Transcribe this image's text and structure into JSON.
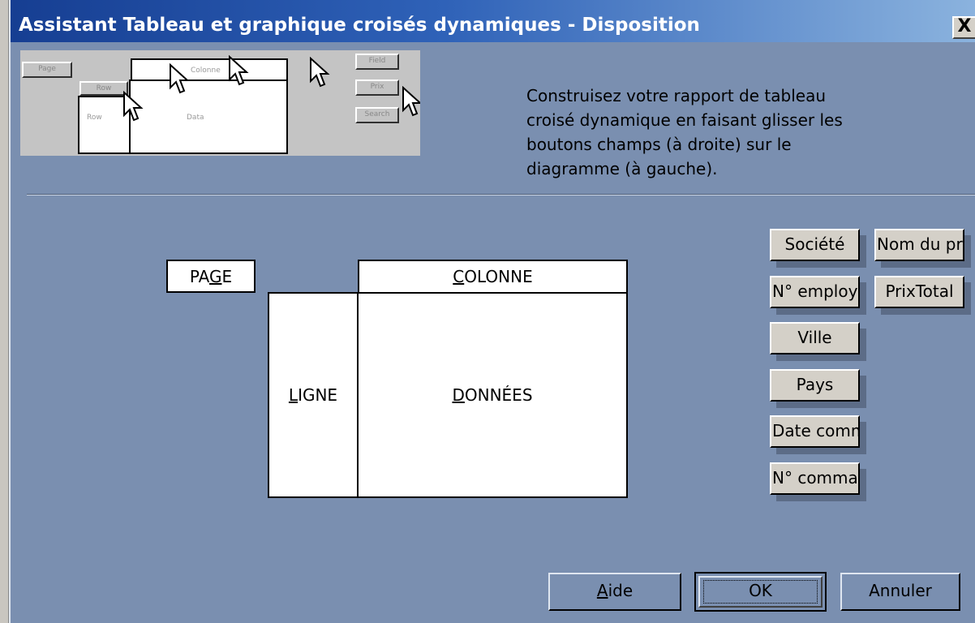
{
  "dialog": {
    "title": "Assistant Tableau et graphique croisés dynamiques - Disposition",
    "close_symbol": "X"
  },
  "preview": {
    "buttons": [
      "Page",
      "Colonne",
      "Row",
      "Field",
      "Data",
      "Prix",
      "Search"
    ],
    "labels": [
      "Row",
      "Data"
    ]
  },
  "instructions": "Construisez votre rapport de tableau croisé dynamique en faisant glisser les boutons champs (à droite) sur le diagramme (à gauche).",
  "layout": {
    "page": {
      "pre": "PA",
      "accel": "G",
      "post": "E"
    },
    "colonne": {
      "pre": "",
      "accel": "C",
      "post": "OLONNE"
    },
    "ligne": {
      "pre": "",
      "accel": "L",
      "post": "IGNE"
    },
    "donnees": {
      "pre": "",
      "accel": "D",
      "post": "ONNÉES"
    }
  },
  "fields": [
    "Société",
    "Nom du pr",
    "N° employ",
    "PrixTotal",
    "Ville",
    "Pays",
    "Date comm",
    "N° comma"
  ],
  "buttons": {
    "help": {
      "pre": "",
      "accel": "A",
      "post": "ide"
    },
    "ok": "OK",
    "cancel": "Annuler"
  },
  "colors": {
    "dialog_bg": "#7a8fb0",
    "titlebar_start": "#163e92",
    "titlebar_end": "#8bb3de",
    "field_button_bg": "#d4d0c8"
  }
}
